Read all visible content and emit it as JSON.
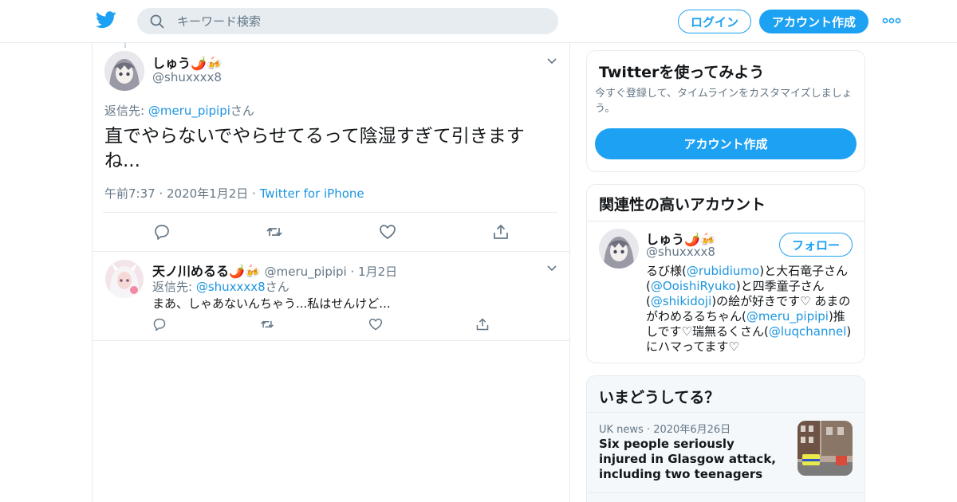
{
  "header": {
    "search_placeholder": "キーワード検索",
    "login_label": "ログイン",
    "signup_label": "アカウント作成",
    "brand_color": "#1da1f2"
  },
  "main_tweet": {
    "display_name": "しゅう🌶️🍻",
    "handle": "@shuxxxx8",
    "reply_prefix": "返信先: ",
    "reply_to": "@meru_pipipi",
    "reply_suffix": "さん",
    "text": "直でやらないでやらせてるって陰湿すぎて引きますね...",
    "time": "午前7:37",
    "date": "2020年1月2日",
    "source": "Twitter for iPhone"
  },
  "reply_tweet": {
    "display_name": "天ノ川めるる🌶️🍻",
    "handle": "@meru_pipipi",
    "date": "1月2日",
    "reply_prefix": "返信先: ",
    "reply_to": "@shuxxxx8",
    "reply_suffix": "さん",
    "text": "まあ、しゃあないんちゃう...私はせんけど..."
  },
  "signup_card": {
    "title": "Twitterを使ってみよう",
    "description": "今すぐ登録して、タイムラインをカスタマイズしましょう。",
    "button_label": "アカウント作成"
  },
  "related_card": {
    "title": "関連性の高いアカウント",
    "display_name": "しゅう🌶️🍻",
    "handle": "@shuxxxx8",
    "follow_label": "フォロー",
    "bio": [
      {
        "t": "るび様(",
        "link": false
      },
      {
        "t": "@rubidiumo",
        "link": true
      },
      {
        "t": ")と大石竜子さん(",
        "link": false
      },
      {
        "t": "@OoishiRyuko",
        "link": true
      },
      {
        "t": ")と四季童子さん(",
        "link": false
      },
      {
        "t": "@shikidoji",
        "link": true
      },
      {
        "t": ")の絵が好きです♡ あまのがわめるるちゃん(",
        "link": false
      },
      {
        "t": "@meru_pipipi",
        "link": true
      },
      {
        "t": ")推しです♡瑞無るくさん(",
        "link": false
      },
      {
        "t": "@luqchannel",
        "link": true
      },
      {
        "t": ")にハマってます♡",
        "link": false
      }
    ]
  },
  "trends_card": {
    "title": "いまどうしてる？",
    "category": "UK news",
    "date": "2020年6月26日",
    "headline": "Six people seriously injured in Glasgow attack, including two teenagers"
  }
}
